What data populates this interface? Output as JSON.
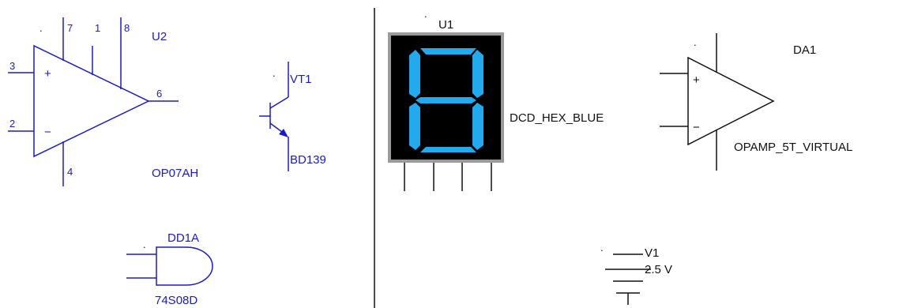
{
  "colors": {
    "blue_component": "#1a1acc",
    "black": "#111111",
    "display_body": "#000000",
    "display_frame": "#9a9a9a",
    "segment": "#22aaee"
  },
  "components": {
    "u2": {
      "ref": "U2",
      "model": "OP07AH",
      "pins": {
        "p3": "3",
        "p2": "2",
        "p7": "7",
        "p1": "1",
        "p8": "8",
        "p6": "6",
        "p4": "4"
      },
      "plus_sign": "+",
      "minus_sign": "−",
      "dot": "."
    },
    "vt1": {
      "ref": "VT1",
      "model": "BD139",
      "dot": "."
    },
    "dd1a": {
      "ref": "DD1A",
      "model": "74S08D",
      "dot": "."
    },
    "u1": {
      "ref": "U1",
      "model": "DCD_HEX_BLUE",
      "dot": "."
    },
    "da1": {
      "ref": "DA1",
      "model": "OPAMP_5T_VIRTUAL",
      "plus_sign": "+",
      "minus_sign": "−",
      "dot": "."
    },
    "v1": {
      "ref": "V1",
      "value": "2.5 V",
      "dot": "."
    }
  }
}
